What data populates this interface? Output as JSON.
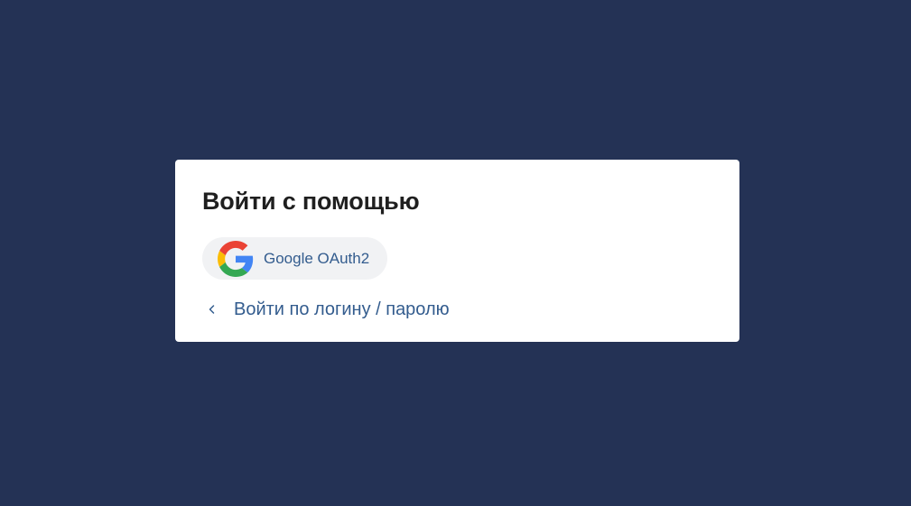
{
  "login": {
    "title": "Войти с помощью",
    "providers": [
      {
        "label": "Google OAuth2",
        "icon": "google-logo-icon"
      }
    ],
    "back_link": {
      "label": "Войти по логину / паролю",
      "icon": "chevron-left-icon"
    }
  },
  "colors": {
    "background": "#243255",
    "card": "#ffffff",
    "title": "#1f1f1f",
    "link": "#335c8e",
    "provider_button_bg": "#f1f2f4"
  }
}
